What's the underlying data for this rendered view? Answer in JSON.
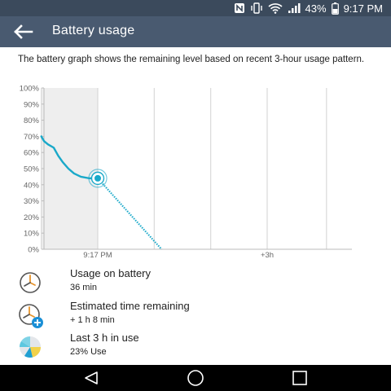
{
  "status_bar": {
    "battery_percent": "43%",
    "time": "9:17 PM",
    "icons": [
      "nfc-icon",
      "vibrate-icon",
      "wifi-icon",
      "signal-icon",
      "battery-icon"
    ]
  },
  "app_bar": {
    "title": "Battery usage",
    "back_icon": "arrow-left-icon"
  },
  "description": "The battery graph shows the remaining level based on recent 3-hour usage pattern.",
  "chart_data": {
    "type": "line",
    "y_tick_labels": [
      "100%",
      "90%",
      "80%",
      "70%",
      "60%",
      "50%",
      "40%",
      "30%",
      "20%",
      "10%",
      "0%"
    ],
    "x_tick_labels": [
      "9:17 PM",
      "+3h"
    ],
    "ylim": [
      0,
      100
    ],
    "grid": true,
    "series": [
      {
        "values_percent_by_hours_from_now": [
          [
            -1,
            70
          ],
          [
            -0.95,
            67
          ],
          [
            -0.88,
            65
          ],
          [
            -0.78,
            63
          ],
          [
            -0.7,
            58
          ],
          [
            -0.62,
            54
          ],
          [
            -0.52,
            50
          ],
          [
            -0.42,
            47
          ],
          [
            -0.3,
            45
          ],
          [
            -0.15,
            44
          ],
          [
            0,
            44
          ]
        ]
      },
      {
        "values_percent_by_hours_from_now": [
          [
            0,
            44
          ],
          [
            1.13,
            0
          ]
        ]
      }
    ],
    "colors": {
      "line": "#1aa9c9",
      "past_region": "#eeeeee",
      "grid": "#d9d9d9"
    }
  },
  "info_rows": [
    {
      "title": "Usage on battery",
      "value": "36 min",
      "icon": "clock-icon"
    },
    {
      "title": "Estimated time remaining",
      "value": "+ 1 h 8 min",
      "icon": "clock-plus-icon"
    },
    {
      "title": "Last 3 h in use",
      "value": "23% Use",
      "icon": "pie-usage-icon"
    }
  ],
  "nav_bar": {
    "icons": [
      "back-triangle-icon",
      "home-circle-icon",
      "recents-square-icon"
    ]
  },
  "colors": {
    "status_bar": "#3b4a5c",
    "app_bar": "#495a70",
    "accent": "#1aa9c9"
  }
}
